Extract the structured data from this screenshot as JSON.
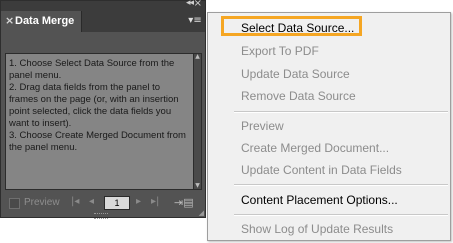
{
  "panel": {
    "title": "Data Merge",
    "instructions": [
      "1. Choose Select Data Source from the panel menu.",
      "2. Drag data fields from the panel to frames on the page (or, with an insertion point selected, click the data fields you want to insert).",
      "3. Choose Create Merged Document from the panel menu."
    ],
    "footer": {
      "preview_label": "Preview",
      "page_number": "1"
    }
  },
  "menu": {
    "items": [
      {
        "label": "Select Data Source...",
        "enabled": true
      },
      {
        "label": "Export To PDF",
        "enabled": false
      },
      {
        "label": "Update Data Source",
        "enabled": false
      },
      {
        "label": "Remove Data Source",
        "enabled": false
      },
      {
        "label": "Preview",
        "enabled": false
      },
      {
        "label": "Create Merged Document...",
        "enabled": false
      },
      {
        "label": "Update Content in Data Fields",
        "enabled": false
      },
      {
        "label": "Content Placement Options...",
        "enabled": true
      },
      {
        "label": "Show Log of Update Results",
        "enabled": false
      }
    ],
    "highlight_color": "#f5a623"
  }
}
